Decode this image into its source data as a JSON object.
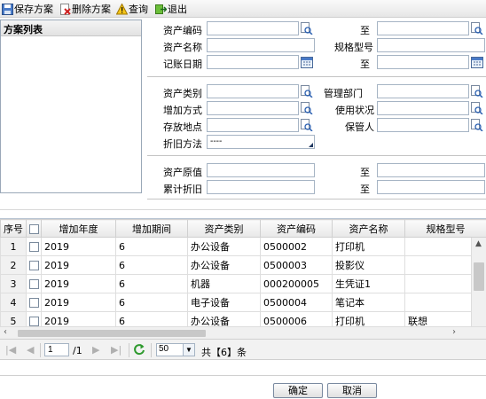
{
  "toolbar": {
    "save_label": "保存方案",
    "delete_label": "删除方案",
    "query_label": "查询",
    "exit_label": "退出"
  },
  "left_panel": {
    "title": "方案列表"
  },
  "form": {
    "asset_code": "资产编码",
    "to1": "至",
    "asset_name": "资产名称",
    "spec_model": "规格型号",
    "post_date": "记账日期",
    "to2": "至",
    "asset_type": "资产类别",
    "mgmt_dept": "管理部门",
    "add_method": "增加方式",
    "use_status": "使用状况",
    "location": "存放地点",
    "custodian": "保管人",
    "depr_method": "折旧方法",
    "depr_method_value": "----",
    "orig_value": "资产原值",
    "to3": "至",
    "accum_depr": "累计折旧",
    "to4": "至"
  },
  "grid": {
    "headers": [
      "序号",
      "",
      "增加年度",
      "增加期间",
      "资产类别",
      "资产编码",
      "资产名称",
      "规格型号"
    ],
    "rows": [
      {
        "no": "1",
        "year": "2019",
        "period": "6",
        "type": "办公设备",
        "code": "0500002",
        "name": "打印机",
        "model": ""
      },
      {
        "no": "2",
        "year": "2019",
        "period": "6",
        "type": "办公设备",
        "code": "0500003",
        "name": "投影仪",
        "model": ""
      },
      {
        "no": "3",
        "year": "2019",
        "period": "6",
        "type": "机器",
        "code": "000200005",
        "name": "生凭证1",
        "model": ""
      },
      {
        "no": "4",
        "year": "2019",
        "period": "6",
        "type": "电子设备",
        "code": "0500004",
        "name": "笔记本",
        "model": ""
      },
      {
        "no": "5",
        "year": "2019",
        "period": "6",
        "type": "办公设备",
        "code": "0500006",
        "name": "打印机",
        "model": "联想"
      }
    ]
  },
  "pager": {
    "page": "1",
    "total_pages": "/1",
    "page_size": "50",
    "total_label": "共【6】条"
  },
  "buttons": {
    "ok": "确定",
    "cancel": "取消"
  }
}
